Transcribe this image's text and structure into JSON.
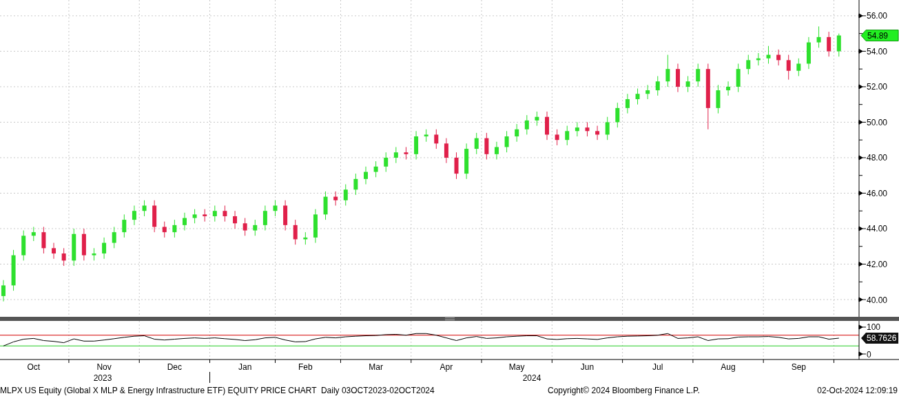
{
  "price_chart": {
    "chart_data": {
      "type": "candlestick",
      "grid": true,
      "ylim": [
        39.03,
        56.89
      ],
      "yticks": [
        {
          "value": 40,
          "label": "40.00"
        },
        {
          "value": 42,
          "label": "42.00"
        },
        {
          "value": 44,
          "label": "44.00"
        },
        {
          "value": 46,
          "label": "46.00"
        },
        {
          "value": 48,
          "label": "48.00"
        },
        {
          "value": 50,
          "label": "50.00"
        },
        {
          "value": 52,
          "label": "52.00"
        },
        {
          "value": 54,
          "label": "54.00"
        },
        {
          "value": 56,
          "label": "56.00"
        }
      ],
      "ohlc": [
        [
          40.2,
          41.1,
          39.9,
          40.8
        ],
        [
          40.8,
          42.8,
          40.5,
          42.5
        ],
        [
          42.5,
          43.9,
          42.2,
          43.6
        ],
        [
          43.6,
          44.1,
          43.3,
          43.8
        ],
        [
          43.8,
          44.1,
          42.6,
          42.9
        ],
        [
          42.9,
          43.2,
          42.3,
          42.6
        ],
        [
          42.6,
          42.9,
          41.9,
          42.2
        ],
        [
          42.2,
          44.0,
          41.9,
          43.7
        ],
        [
          43.7,
          44.0,
          42.2,
          42.5
        ],
        [
          42.5,
          42.9,
          42.2,
          42.6
        ],
        [
          42.6,
          43.5,
          42.3,
          43.2
        ],
        [
          43.2,
          44.1,
          42.9,
          43.8
        ],
        [
          43.8,
          44.8,
          43.5,
          44.5
        ],
        [
          44.5,
          45.3,
          44.2,
          45.0
        ],
        [
          45.0,
          45.6,
          44.7,
          45.3
        ],
        [
          45.3,
          45.6,
          43.8,
          44.1
        ],
        [
          44.1,
          44.4,
          43.5,
          43.8
        ],
        [
          43.8,
          44.5,
          43.5,
          44.2
        ],
        [
          44.2,
          44.9,
          43.9,
          44.6
        ],
        [
          44.6,
          45.1,
          44.3,
          44.8
        ],
        [
          44.8,
          45.1,
          44.4,
          44.7
        ],
        [
          44.7,
          45.3,
          44.4,
          45.0
        ],
        [
          45.0,
          45.3,
          44.4,
          44.7
        ],
        [
          44.7,
          45.0,
          44.0,
          44.3
        ],
        [
          44.3,
          44.6,
          43.6,
          43.9
        ],
        [
          43.9,
          44.5,
          43.6,
          44.2
        ],
        [
          44.2,
          45.3,
          43.9,
          45.0
        ],
        [
          45.0,
          45.6,
          44.7,
          45.3
        ],
        [
          45.3,
          45.6,
          43.9,
          44.2
        ],
        [
          44.2,
          44.5,
          43.1,
          43.4
        ],
        [
          43.4,
          43.8,
          43.1,
          43.5
        ],
        [
          43.5,
          45.1,
          43.2,
          44.8
        ],
        [
          44.8,
          46.1,
          44.5,
          45.8
        ],
        [
          45.8,
          46.1,
          45.3,
          45.6
        ],
        [
          45.6,
          46.5,
          45.3,
          46.2
        ],
        [
          46.2,
          47.1,
          45.9,
          46.8
        ],
        [
          46.8,
          47.5,
          46.5,
          47.2
        ],
        [
          47.2,
          47.8,
          46.9,
          47.5
        ],
        [
          47.5,
          48.3,
          47.2,
          48.0
        ],
        [
          48.0,
          48.6,
          47.7,
          48.3
        ],
        [
          48.3,
          48.6,
          47.9,
          48.2
        ],
        [
          48.2,
          49.5,
          47.9,
          49.2
        ],
        [
          49.2,
          49.6,
          48.9,
          49.3
        ],
        [
          49.3,
          49.6,
          48.5,
          48.8
        ],
        [
          48.8,
          49.1,
          47.7,
          48.0
        ],
        [
          48.0,
          48.3,
          46.8,
          47.1
        ],
        [
          47.1,
          48.8,
          46.8,
          48.5
        ],
        [
          48.5,
          49.4,
          48.2,
          49.1
        ],
        [
          49.1,
          49.4,
          47.9,
          48.2
        ],
        [
          48.2,
          48.9,
          47.9,
          48.6
        ],
        [
          48.6,
          49.5,
          48.3,
          49.2
        ],
        [
          49.2,
          49.9,
          48.9,
          49.6
        ],
        [
          49.6,
          50.4,
          49.3,
          50.1
        ],
        [
          50.1,
          50.6,
          49.8,
          50.3
        ],
        [
          50.3,
          50.6,
          49.0,
          49.3
        ],
        [
          49.3,
          49.6,
          48.7,
          49.0
        ],
        [
          49.0,
          49.8,
          48.7,
          49.5
        ],
        [
          49.5,
          50.0,
          49.2,
          49.7
        ],
        [
          49.7,
          50.0,
          49.2,
          49.5
        ],
        [
          49.5,
          49.8,
          49.0,
          49.3
        ],
        [
          49.3,
          50.3,
          49.0,
          50.0
        ],
        [
          50.0,
          51.1,
          49.7,
          50.8
        ],
        [
          50.8,
          51.6,
          50.5,
          51.3
        ],
        [
          51.3,
          51.9,
          51.0,
          51.6
        ],
        [
          51.6,
          52.1,
          51.3,
          51.8
        ],
        [
          51.8,
          52.6,
          51.5,
          52.3
        ],
        [
          52.3,
          53.8,
          52.0,
          53.0
        ],
        [
          53.0,
          53.3,
          51.7,
          52.0
        ],
        [
          52.0,
          52.6,
          51.7,
          52.3
        ],
        [
          52.3,
          53.3,
          52.0,
          53.0
        ],
        [
          53.0,
          53.3,
          49.6,
          50.8
        ],
        [
          50.8,
          52.1,
          50.5,
          51.8
        ],
        [
          51.8,
          52.3,
          51.5,
          52.0
        ],
        [
          52.0,
          53.3,
          51.7,
          53.0
        ],
        [
          53.0,
          53.8,
          52.7,
          53.5
        ],
        [
          53.5,
          53.9,
          53.2,
          53.6
        ],
        [
          53.6,
          54.3,
          53.3,
          53.8
        ],
        [
          53.8,
          54.1,
          53.2,
          53.5
        ],
        [
          53.5,
          53.8,
          52.4,
          52.9
        ],
        [
          52.9,
          53.6,
          52.6,
          53.3
        ],
        [
          53.3,
          54.8,
          53.0,
          54.5
        ],
        [
          54.5,
          55.4,
          54.2,
          54.8
        ],
        [
          54.8,
          55.1,
          53.7,
          54.0
        ],
        [
          54.0,
          55.0,
          53.7,
          54.89
        ]
      ]
    },
    "last_price": "54.89"
  },
  "indicator_chart": {
    "chart_data": {
      "type": "line",
      "grid": true,
      "ylim": [
        -20.5,
        123
      ],
      "categories": [
        null,
        null,
        null,
        "Oct",
        null,
        null,
        null,
        null,
        null,
        null,
        "Nov",
        null,
        null,
        null,
        null,
        null,
        null,
        "Dec",
        null,
        null,
        null,
        null,
        null,
        null,
        "Jan",
        null,
        null,
        null,
        null,
        null,
        "Feb",
        null,
        null,
        null,
        null,
        null,
        null,
        "Mar",
        null,
        null,
        null,
        null,
        null,
        null,
        "Apr",
        null,
        null,
        null,
        null,
        null,
        null,
        "May",
        null,
        null,
        null,
        null,
        null,
        null,
        "Jun",
        null,
        null,
        null,
        null,
        null,
        null,
        "Jul",
        null,
        null,
        null,
        null,
        null,
        null,
        "Aug",
        null,
        null,
        null,
        null,
        null,
        null,
        "Sep",
        null,
        null,
        null,
        null
      ],
      "yticks": [
        {
          "value": 0,
          "label": "0"
        },
        {
          "value": 100,
          "label": "100"
        }
      ],
      "ref_lines": [
        {
          "axis": "y",
          "value": 70,
          "color": "#d40000"
        },
        {
          "axis": "y",
          "value": 30,
          "color": "#22cc22"
        }
      ],
      "values": [
        30,
        45,
        55,
        58,
        50,
        47,
        42,
        56,
        48,
        48,
        52,
        57,
        62,
        66,
        68,
        55,
        52,
        55,
        58,
        60,
        58,
        60,
        57,
        54,
        50,
        53,
        60,
        62,
        52,
        45,
        46,
        56,
        62,
        60,
        64,
        66,
        68,
        69,
        72,
        73,
        70,
        76,
        76,
        70,
        60,
        50,
        60,
        65,
        58,
        60,
        64,
        66,
        68,
        68,
        56,
        54,
        57,
        58,
        56,
        54,
        60,
        64,
        66,
        67,
        68,
        70,
        76,
        58,
        60,
        64,
        50,
        56,
        57,
        63,
        64,
        64,
        65,
        62,
        56,
        58,
        64,
        64,
        55,
        59
      ]
    },
    "last_value": "58.7626"
  },
  "years": [
    "2023",
    "2024"
  ],
  "footer": {
    "title": "MLPX US Equity (Global X MLP & Energy Infrastructure ETF) EQUITY PRICE CHART  Daily 03OCT2023-02OCT2024",
    "copyright": "Copyright© 2024 Bloomberg Finance L.P.",
    "timestamp": "02-Oct-2024 12:09:19"
  }
}
